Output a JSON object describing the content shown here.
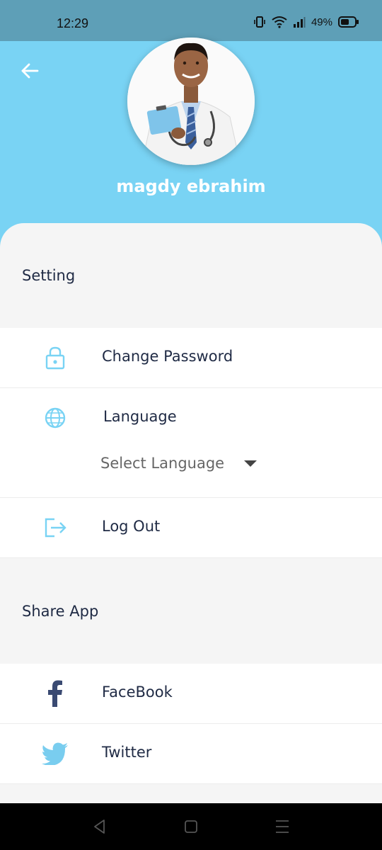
{
  "status_bar": {
    "time": "12:29",
    "battery": "49%"
  },
  "profile": {
    "name": "magdy ebrahim"
  },
  "settings": {
    "title": "Setting",
    "change_password": "Change Password",
    "language": "Language",
    "select_language": "Select Language",
    "log_out": "Log Out"
  },
  "share": {
    "title": "Share App",
    "facebook": "FaceBook",
    "twitter": "Twitter"
  },
  "colors": {
    "header": "#79d3f4",
    "status_bar": "#5e9fb7",
    "icon_accent": "#79d3f4",
    "text": "#1f2a44"
  },
  "icons": [
    "back-arrow-icon",
    "lock-icon",
    "globe-icon",
    "logout-icon",
    "facebook-icon",
    "twitter-icon"
  ]
}
